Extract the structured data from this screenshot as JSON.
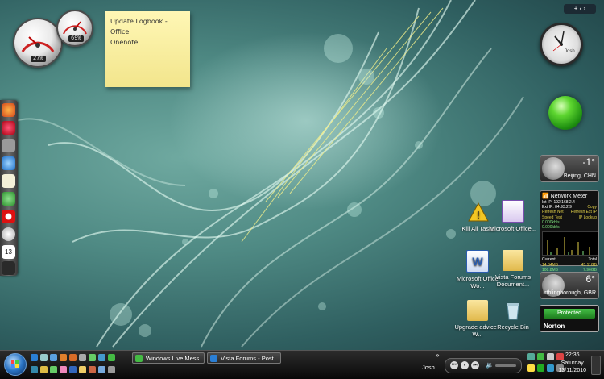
{
  "sticky_note": {
    "line1": "Update Logbook - Office",
    "line2": "Onenote"
  },
  "gauges": {
    "cpu": "27%",
    "memory": "69%"
  },
  "sidebar_controls": {
    "add": "+",
    "nav": "‹ ›"
  },
  "clock": {
    "label": "Josh"
  },
  "weather": [
    {
      "temp": "-1°",
      "city": "Beijing, CHN"
    },
    {
      "temp": "6°",
      "city": "Irthlingborough, GBR"
    }
  ],
  "network_meter": {
    "title": "Network Meter",
    "int_ip": "Int IP: 192.168.2.4",
    "ext_ip": "Ext IP: 84.93.2.9",
    "copy": "Copy",
    "refresh_net": "Refresh Net",
    "refresh_ext": "Refresh Ext IP",
    "speed_test": "Speed Test",
    "ip_lookup": "IP Lookup",
    "speed_up": "0.000kb/s",
    "speed_down": "0.000kb/s",
    "current": "Current",
    "total": "Total",
    "cur_up": "14.34MB",
    "cur_down": "108.8MB",
    "tot_up": "45.11GB",
    "tot_down": "7.96GB"
  },
  "norton": {
    "status": "Protected",
    "brand": "Norton"
  },
  "desktop_icons": [
    {
      "label": "Kill All Tasks",
      "icon": "warning-icon"
    },
    {
      "label": "Microsoft Office...",
      "icon": "onenote-icon"
    },
    {
      "label": "Microsoft Office Wo...",
      "icon": "word-icon"
    },
    {
      "label": "Vista Forums Document...",
      "icon": "folder-icon"
    },
    {
      "label": "Upgrade advice -W...",
      "icon": "folder-icon"
    },
    {
      "label": "Recycle Bin",
      "icon": "recycle-bin-icon"
    }
  ],
  "taskbar": {
    "tasks": [
      {
        "label": "Windows Live Mess..."
      },
      {
        "label": "Vista Forums - Post ..."
      }
    ],
    "user": "Josh",
    "chevron": "»",
    "time": "22:36",
    "day": "Saturday",
    "date": "13/11/2010"
  },
  "colors": {
    "accent_green": "#34b234",
    "taskbar": "#1a1a1a",
    "desktop": "#4f8a84"
  }
}
